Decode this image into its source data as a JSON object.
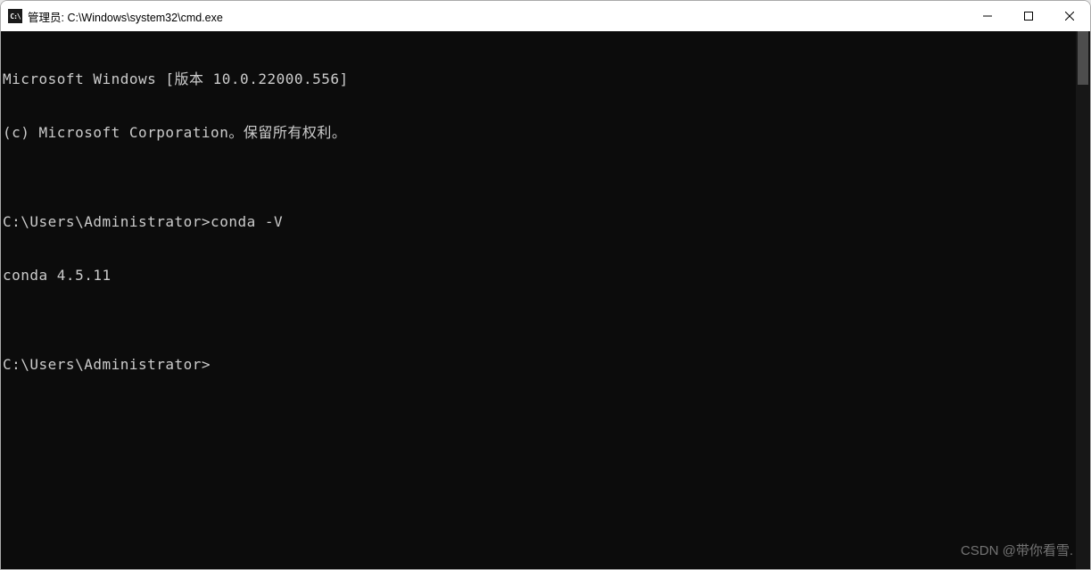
{
  "titlebar": {
    "icon_text": "C:\\",
    "title": "管理员: C:\\Windows\\system32\\cmd.exe"
  },
  "terminal": {
    "lines": [
      "Microsoft Windows [版本 10.0.22000.556]",
      "(c) Microsoft Corporation。保留所有权利。",
      "",
      "C:\\Users\\Administrator>conda -V",
      "conda 4.5.11",
      "",
      "C:\\Users\\Administrator>"
    ]
  },
  "watermark": "CSDN @带你看雪."
}
